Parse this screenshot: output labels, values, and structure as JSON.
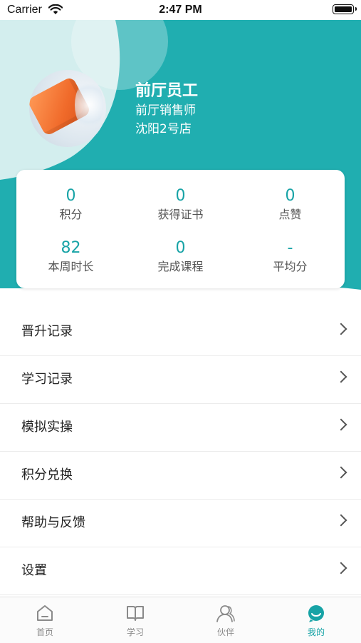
{
  "status_bar": {
    "carrier": "Carrier",
    "time": "2:47 PM"
  },
  "profile": {
    "name": "前厅员工",
    "role": "前厅销售师",
    "store": "沈阳2号店",
    "avatar": "avatar-image"
  },
  "stats": [
    {
      "value": "0",
      "label": "积分"
    },
    {
      "value": "0",
      "label": "获得证书"
    },
    {
      "value": "0",
      "label": "点赞"
    },
    {
      "value": "82",
      "label": "本周时长"
    },
    {
      "value": "0",
      "label": "完成课程"
    },
    {
      "value": "-",
      "label": "平均分"
    }
  ],
  "menu": [
    {
      "label": "晋升记录"
    },
    {
      "label": "学习记录"
    },
    {
      "label": "模拟实操"
    },
    {
      "label": "积分兑换"
    },
    {
      "label": "帮助与反馈"
    },
    {
      "label": "设置"
    }
  ],
  "tabs": [
    {
      "label": "首页",
      "icon": "home-icon"
    },
    {
      "label": "学习",
      "icon": "book-icon"
    },
    {
      "label": "伙伴",
      "icon": "partners-icon"
    },
    {
      "label": "我的",
      "icon": "me-icon",
      "active": true
    }
  ],
  "colors": {
    "accent": "#17a3a6",
    "header": "#20aeb0",
    "header_light": "#d3eeee"
  }
}
